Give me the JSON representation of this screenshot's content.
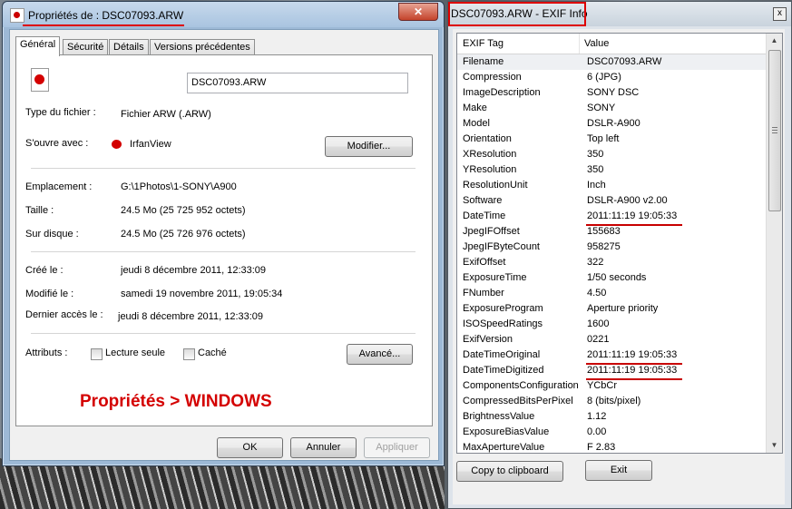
{
  "props": {
    "title": "Propriétés de : DSC07093.ARW",
    "close": "✕",
    "tabs": [
      "Général",
      "Sécurité",
      "Détails",
      "Versions précédentes"
    ],
    "filename": "DSC07093.ARW",
    "type_label": "Type du fichier :",
    "type_value": "Fichier ARW (.ARW)",
    "open_label": "S'ouvre avec :",
    "open_value": "IrfanView",
    "modify_button": "Modifier...",
    "location_label": "Emplacement :",
    "location_value": "G:\\1Photos\\1-SONY\\A900",
    "size_label": "Taille :",
    "size_value": "24.5 Mo (25 725 952 octets)",
    "disk_label": "Sur disque :",
    "disk_value": "24.5 Mo (25 726 976 octets)",
    "created_label": "Créé le :",
    "created_value": "jeudi 8 décembre 2011, 12:33:09",
    "modified_label": "Modifié le :",
    "modified_value": "samedi 19 novembre 2011, 19:05:34",
    "accessed_label": "Dernier accès le :",
    "accessed_value": "jeudi 8 décembre 2011, 12:33:09",
    "attributes_label": "Attributs :",
    "readonly_label": "Lecture seule",
    "hidden_label": "Caché",
    "advanced_button": "Avancé...",
    "note": "Propriétés > WINDOWS",
    "ok_button": "OK",
    "cancel_button": "Annuler",
    "apply_button": "Appliquer"
  },
  "exif": {
    "title": "DSC07093.ARW - EXIF Info",
    "close": "x",
    "col_tag": "EXIF Tag",
    "col_value": "Value",
    "rows": [
      [
        "Filename",
        "DSC07093.ARW"
      ],
      [
        "Compression",
        "6 (JPG)"
      ],
      [
        "ImageDescription",
        "SONY DSC"
      ],
      [
        "Make",
        "SONY"
      ],
      [
        "Model",
        "DSLR-A900"
      ],
      [
        "Orientation",
        "Top left"
      ],
      [
        "XResolution",
        "350"
      ],
      [
        "YResolution",
        "350"
      ],
      [
        "ResolutionUnit",
        "Inch"
      ],
      [
        "Software",
        "DSLR-A900 v2.00"
      ],
      [
        "DateTime",
        "2011:11:19 19:05:33"
      ],
      [
        "JpegIFOffset",
        "155683"
      ],
      [
        "JpegIFByteCount",
        "958275"
      ],
      [
        "ExifOffset",
        "322"
      ],
      [
        "ExposureTime",
        "1/50 seconds"
      ],
      [
        "FNumber",
        "4.50"
      ],
      [
        "ExposureProgram",
        "Aperture priority"
      ],
      [
        "ISOSpeedRatings",
        "1600"
      ],
      [
        "ExifVersion",
        "0221"
      ],
      [
        "DateTimeOriginal",
        "2011:11:19 19:05:33"
      ],
      [
        "DateTimeDigitized",
        "2011:11:19 19:05:33"
      ],
      [
        "ComponentsConfiguration",
        "YCbCr"
      ],
      [
        "CompressedBitsPerPixel",
        "8 (bits/pixel)"
      ],
      [
        "BrightnessValue",
        "1.12"
      ],
      [
        "ExposureBiasValue",
        "0.00"
      ],
      [
        "MaxApertureValue",
        "F 2.83"
      ]
    ],
    "underlined_rows": [
      10,
      19,
      20
    ],
    "copy_button": "Copy to clipboard",
    "exit_button": "Exit"
  }
}
